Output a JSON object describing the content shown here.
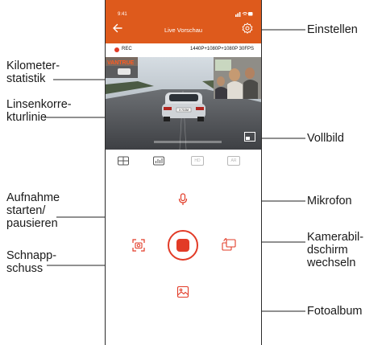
{
  "status_bar": {
    "time": "9:41"
  },
  "header": {
    "title": "Live Vorschau",
    "back_icon": "back-arrow-icon",
    "settings_icon": "gear-icon",
    "accent_color": "#de5a1c"
  },
  "recording": {
    "label": "REC",
    "resolution": "1440P+1080P+1080P 30FPS",
    "indicator_color": "#e23b27"
  },
  "video_overlay": {
    "brand_text": "VANTRUE",
    "plate_text": "X 73 2M"
  },
  "tools": [
    {
      "name": "grid-icon"
    },
    {
      "name": "mileage-icon"
    },
    {
      "name": "hd-badge",
      "label": "HD"
    },
    {
      "name": "ar-badge",
      "label": "AR"
    }
  ],
  "callouts": {
    "settings": "Einstellen",
    "mileage": [
      "Kilometer-",
      "statistik"
    ],
    "lens": [
      "Linsenkorre-",
      "kturlinie"
    ],
    "fullscreen": "Vollbild",
    "record": [
      "Aufnahme",
      "starten/",
      "pausieren"
    ],
    "mic": "Mikrofon",
    "switch": [
      "Kamerabil-",
      "dschirm",
      "wechseln"
    ],
    "snapshot": [
      "Schnapp-",
      "schuss"
    ],
    "album": "Fotoalbum"
  }
}
